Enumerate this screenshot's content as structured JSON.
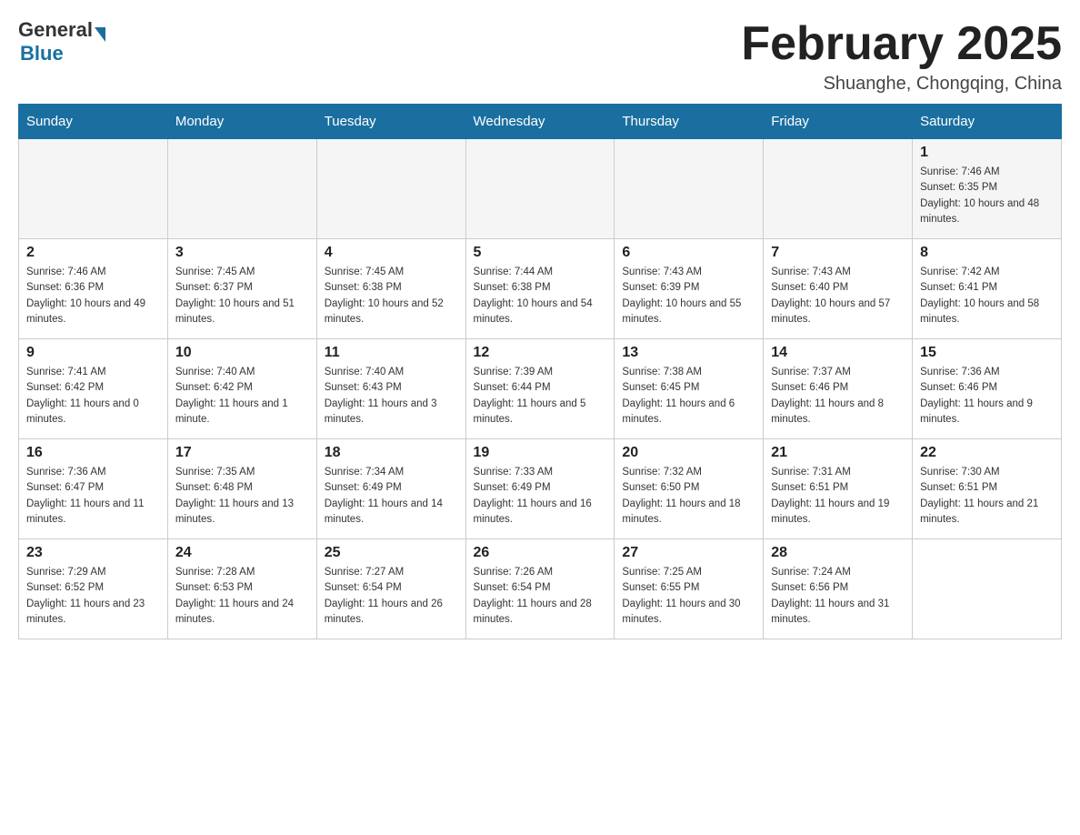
{
  "header": {
    "logo_general": "General",
    "logo_blue": "Blue",
    "title": "February 2025",
    "subtitle": "Shuanghe, Chongqing, China"
  },
  "days_of_week": [
    "Sunday",
    "Monday",
    "Tuesday",
    "Wednesday",
    "Thursday",
    "Friday",
    "Saturday"
  ],
  "weeks": [
    [
      {
        "day": "",
        "sunrise": "",
        "sunset": "",
        "daylight": ""
      },
      {
        "day": "",
        "sunrise": "",
        "sunset": "",
        "daylight": ""
      },
      {
        "day": "",
        "sunrise": "",
        "sunset": "",
        "daylight": ""
      },
      {
        "day": "",
        "sunrise": "",
        "sunset": "",
        "daylight": ""
      },
      {
        "day": "",
        "sunrise": "",
        "sunset": "",
        "daylight": ""
      },
      {
        "day": "",
        "sunrise": "",
        "sunset": "",
        "daylight": ""
      },
      {
        "day": "1",
        "sunrise": "Sunrise: 7:46 AM",
        "sunset": "Sunset: 6:35 PM",
        "daylight": "Daylight: 10 hours and 48 minutes."
      }
    ],
    [
      {
        "day": "2",
        "sunrise": "Sunrise: 7:46 AM",
        "sunset": "Sunset: 6:36 PM",
        "daylight": "Daylight: 10 hours and 49 minutes."
      },
      {
        "day": "3",
        "sunrise": "Sunrise: 7:45 AM",
        "sunset": "Sunset: 6:37 PM",
        "daylight": "Daylight: 10 hours and 51 minutes."
      },
      {
        "day": "4",
        "sunrise": "Sunrise: 7:45 AM",
        "sunset": "Sunset: 6:38 PM",
        "daylight": "Daylight: 10 hours and 52 minutes."
      },
      {
        "day": "5",
        "sunrise": "Sunrise: 7:44 AM",
        "sunset": "Sunset: 6:38 PM",
        "daylight": "Daylight: 10 hours and 54 minutes."
      },
      {
        "day": "6",
        "sunrise": "Sunrise: 7:43 AM",
        "sunset": "Sunset: 6:39 PM",
        "daylight": "Daylight: 10 hours and 55 minutes."
      },
      {
        "day": "7",
        "sunrise": "Sunrise: 7:43 AM",
        "sunset": "Sunset: 6:40 PM",
        "daylight": "Daylight: 10 hours and 57 minutes."
      },
      {
        "day": "8",
        "sunrise": "Sunrise: 7:42 AM",
        "sunset": "Sunset: 6:41 PM",
        "daylight": "Daylight: 10 hours and 58 minutes."
      }
    ],
    [
      {
        "day": "9",
        "sunrise": "Sunrise: 7:41 AM",
        "sunset": "Sunset: 6:42 PM",
        "daylight": "Daylight: 11 hours and 0 minutes."
      },
      {
        "day": "10",
        "sunrise": "Sunrise: 7:40 AM",
        "sunset": "Sunset: 6:42 PM",
        "daylight": "Daylight: 11 hours and 1 minute."
      },
      {
        "day": "11",
        "sunrise": "Sunrise: 7:40 AM",
        "sunset": "Sunset: 6:43 PM",
        "daylight": "Daylight: 11 hours and 3 minutes."
      },
      {
        "day": "12",
        "sunrise": "Sunrise: 7:39 AM",
        "sunset": "Sunset: 6:44 PM",
        "daylight": "Daylight: 11 hours and 5 minutes."
      },
      {
        "day": "13",
        "sunrise": "Sunrise: 7:38 AM",
        "sunset": "Sunset: 6:45 PM",
        "daylight": "Daylight: 11 hours and 6 minutes."
      },
      {
        "day": "14",
        "sunrise": "Sunrise: 7:37 AM",
        "sunset": "Sunset: 6:46 PM",
        "daylight": "Daylight: 11 hours and 8 minutes."
      },
      {
        "day": "15",
        "sunrise": "Sunrise: 7:36 AM",
        "sunset": "Sunset: 6:46 PM",
        "daylight": "Daylight: 11 hours and 9 minutes."
      }
    ],
    [
      {
        "day": "16",
        "sunrise": "Sunrise: 7:36 AM",
        "sunset": "Sunset: 6:47 PM",
        "daylight": "Daylight: 11 hours and 11 minutes."
      },
      {
        "day": "17",
        "sunrise": "Sunrise: 7:35 AM",
        "sunset": "Sunset: 6:48 PM",
        "daylight": "Daylight: 11 hours and 13 minutes."
      },
      {
        "day": "18",
        "sunrise": "Sunrise: 7:34 AM",
        "sunset": "Sunset: 6:49 PM",
        "daylight": "Daylight: 11 hours and 14 minutes."
      },
      {
        "day": "19",
        "sunrise": "Sunrise: 7:33 AM",
        "sunset": "Sunset: 6:49 PM",
        "daylight": "Daylight: 11 hours and 16 minutes."
      },
      {
        "day": "20",
        "sunrise": "Sunrise: 7:32 AM",
        "sunset": "Sunset: 6:50 PM",
        "daylight": "Daylight: 11 hours and 18 minutes."
      },
      {
        "day": "21",
        "sunrise": "Sunrise: 7:31 AM",
        "sunset": "Sunset: 6:51 PM",
        "daylight": "Daylight: 11 hours and 19 minutes."
      },
      {
        "day": "22",
        "sunrise": "Sunrise: 7:30 AM",
        "sunset": "Sunset: 6:51 PM",
        "daylight": "Daylight: 11 hours and 21 minutes."
      }
    ],
    [
      {
        "day": "23",
        "sunrise": "Sunrise: 7:29 AM",
        "sunset": "Sunset: 6:52 PM",
        "daylight": "Daylight: 11 hours and 23 minutes."
      },
      {
        "day": "24",
        "sunrise": "Sunrise: 7:28 AM",
        "sunset": "Sunset: 6:53 PM",
        "daylight": "Daylight: 11 hours and 24 minutes."
      },
      {
        "day": "25",
        "sunrise": "Sunrise: 7:27 AM",
        "sunset": "Sunset: 6:54 PM",
        "daylight": "Daylight: 11 hours and 26 minutes."
      },
      {
        "day": "26",
        "sunrise": "Sunrise: 7:26 AM",
        "sunset": "Sunset: 6:54 PM",
        "daylight": "Daylight: 11 hours and 28 minutes."
      },
      {
        "day": "27",
        "sunrise": "Sunrise: 7:25 AM",
        "sunset": "Sunset: 6:55 PM",
        "daylight": "Daylight: 11 hours and 30 minutes."
      },
      {
        "day": "28",
        "sunrise": "Sunrise: 7:24 AM",
        "sunset": "Sunset: 6:56 PM",
        "daylight": "Daylight: 11 hours and 31 minutes."
      },
      {
        "day": "",
        "sunrise": "",
        "sunset": "",
        "daylight": ""
      }
    ]
  ]
}
